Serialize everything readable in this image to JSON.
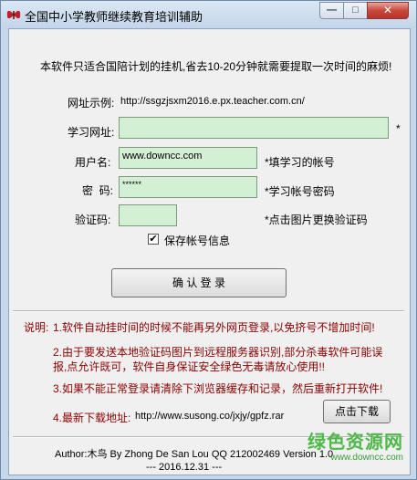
{
  "window": {
    "title": "全国中小学教师继续教育培训辅助",
    "controls": {
      "minimize": "—",
      "maximize": "□",
      "close": "✕"
    }
  },
  "notice": "本软件只适合国陪计划的挂机,省去10-20分钟就需要提取一次时间的麻烦!",
  "url_example": {
    "label": "网址示例:",
    "value": "http://ssgzjsxm2016.e.px.teacher.com.cn/"
  },
  "form": {
    "study_url": {
      "label": "学习网址:",
      "value": "",
      "required_mark": "*"
    },
    "username": {
      "label": "用户名:",
      "value": "www.downcc.com",
      "hint": "*填学习的帐号"
    },
    "password": {
      "label": "密  码:",
      "value": "******",
      "hint": "*学习帐号密码"
    },
    "captcha": {
      "label": "验证码:",
      "value": "",
      "hint": "*点击图片更换验证码"
    },
    "remember": {
      "label": "保存帐号信息",
      "checked": true,
      "check_glyph": "✔"
    },
    "login_button": "确 认 登 录"
  },
  "notes": {
    "title": "说明:",
    "items": [
      "1.软件自动挂时间的时候不能再另外网页登录,以免挤号不增加时间!",
      "2.由于要发送本地验证码图片到远程服务器识别,部分杀毒软件可能误",
      "报,点允许既可，软件自身保证安全绿色无毒请放心使用!!",
      "3.如果不能正常登录请清除下浏览器缓存和记录，然后重新打开软件!",
      "4.最新下载地址:"
    ],
    "download_url": "http://www.susong.co/jxjy/gpfz.rar",
    "download_button": "点击下载"
  },
  "footer": {
    "author": "Author:木鸟  By Zhong De San Lou  QQ 212002469  Version 1.0",
    "date": "--- 2016.12.31 ---"
  },
  "watermark": {
    "text": "绿色资源网",
    "url": "www.downcc.com"
  },
  "colors": {
    "field_bg": "#d4f0d4",
    "notes_text": "#8b0000",
    "close_button": "#c9483b",
    "watermark": "#4fb84a"
  }
}
